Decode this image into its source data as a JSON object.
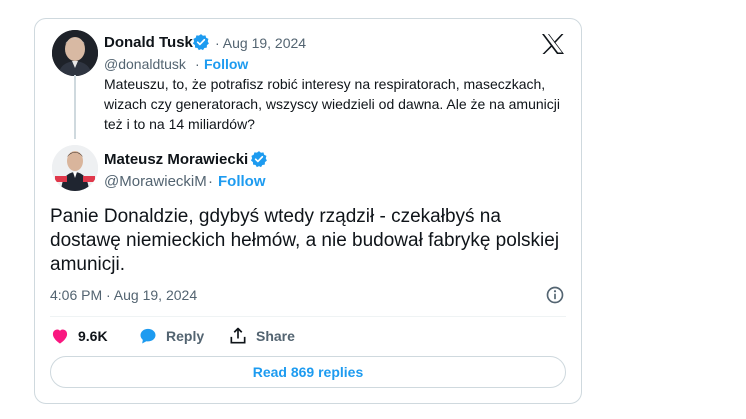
{
  "quoted_tweet": {
    "author_name": "Donald Tusk",
    "date": "· Aug 19, 2024",
    "handle": "@donaldtusk",
    "separator": "·",
    "follow_label": "Follow",
    "text": "Mateuszu, to, że potrafisz robić interesy na respiratorach, maseczkach, wizach czy generatorach, wszyscy wiedzieli od dawna. Ale że na amunicji też i to na 14 miliardów?"
  },
  "reply_tweet": {
    "author_name": "Mateusz Morawiecki",
    "handle": "@MorawieckiM",
    "separator": "·",
    "follow_label": "Follow",
    "text": "Panie Donaldzie, gdybyś wtedy rządził - czekałbyś na dostawę niemieckich hełmów, a nie budował fabrykę polskiej amunicji.",
    "timestamp": "4:06 PM · Aug 19, 2024"
  },
  "actions": {
    "like_count": "9.6K",
    "reply_label": "Reply",
    "share_label": "Share"
  },
  "read_replies_label": "Read 869 replies",
  "colors": {
    "accent": "#1d9bf0",
    "like": "#f91880",
    "muted": "#536471",
    "border": "#cfd9de"
  },
  "icons": [
    "x-logo-icon",
    "verified-badge-icon",
    "heart-icon",
    "reply-bubble-icon",
    "share-icon",
    "info-icon"
  ]
}
